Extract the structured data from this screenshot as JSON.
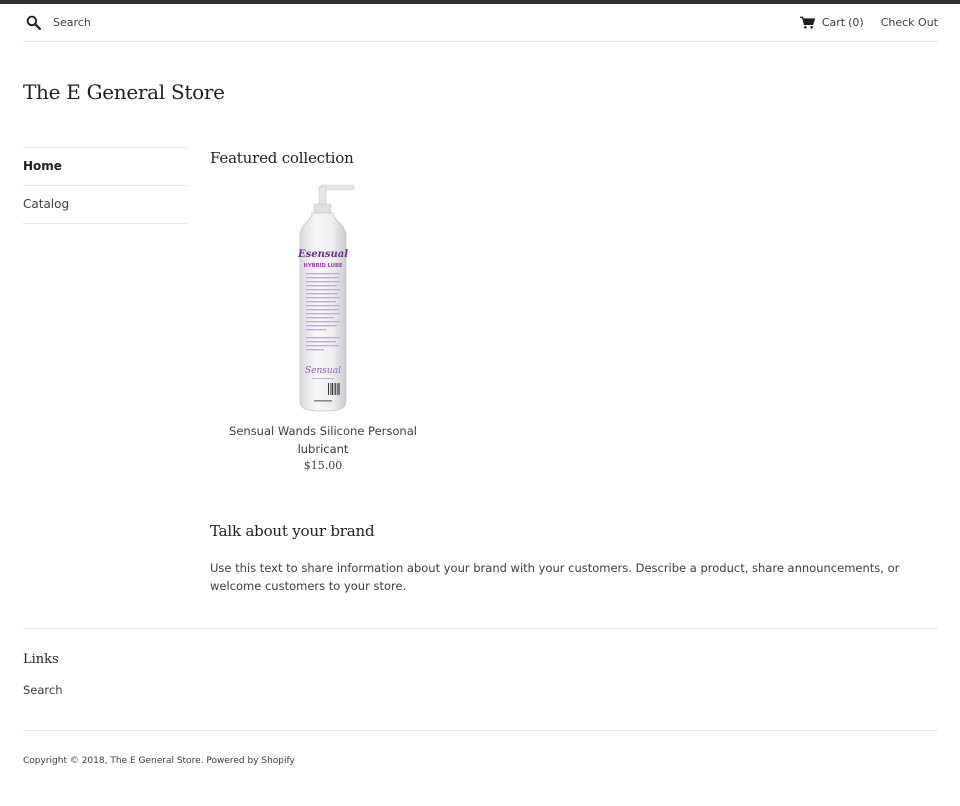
{
  "header": {
    "search_placeholder": "Search",
    "cart_label": "Cart",
    "cart_count": "(0)",
    "checkout_label": "Check Out"
  },
  "store": {
    "name": "The E General Store"
  },
  "sidebar": {
    "items": [
      {
        "label": "Home",
        "active": true
      },
      {
        "label": "Catalog",
        "active": false
      }
    ]
  },
  "featured": {
    "title": "Featured collection",
    "product": {
      "name": "Sensual Wands Silicone Personal lubricant",
      "price": "$15.00",
      "bottle_brand": "Esensual",
      "bottle_product": "HYBRID LUBE",
      "bottle_logo": "Sensual"
    }
  },
  "brand": {
    "title": "Talk about your brand",
    "text": "Use this text to share information about your brand with your customers. Describe a product, share announcements, or welcome customers to your store."
  },
  "footer": {
    "links_title": "Links",
    "links": [
      "Search"
    ],
    "copyright_prefix": "Copyright © 2018,",
    "copyright_store": "The E General Store",
    "powered_by": "Powered by Shopify"
  },
  "colors": {
    "top_border": "#2f2f2f",
    "text": "#3d3d3d",
    "divider": "#e6e6e6",
    "bottle_accent": "#7a3b8f"
  }
}
